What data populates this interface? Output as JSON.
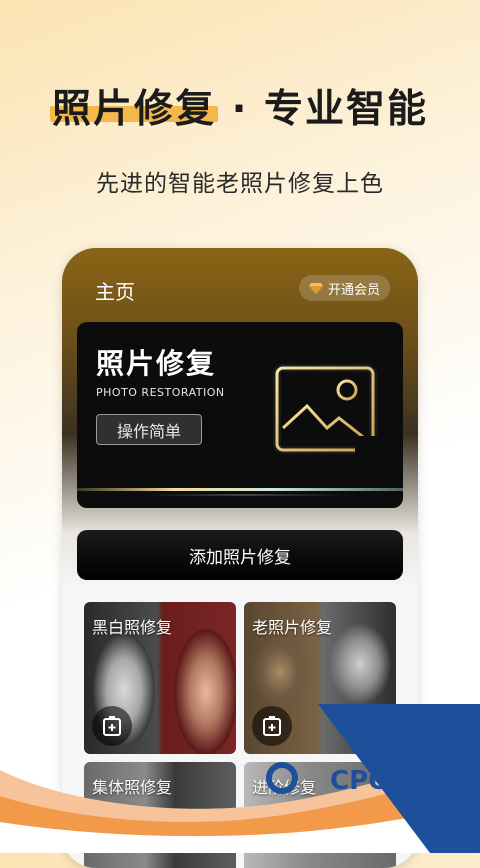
{
  "headline": "照片修复 · 专业智能",
  "subline": "先进的智能老照片修复上色",
  "app": {
    "title": "主页",
    "vip_label": "开通会员",
    "banner": {
      "title": "照片修复",
      "subtitle": "PHOTO RESTORATION",
      "button": "操作简单"
    },
    "add_button": "添加照片修复",
    "cards": [
      {
        "label": "黑白照修复"
      },
      {
        "label": "老照片修复"
      },
      {
        "label": "集体照修复"
      },
      {
        "label": "进阶修复"
      }
    ]
  },
  "watermark": "CPOP下载",
  "colors": {
    "accent_yellow": "#f3b84a",
    "wave_orange": "#f29a4a",
    "watermark_blue": "#1d4f9a"
  }
}
